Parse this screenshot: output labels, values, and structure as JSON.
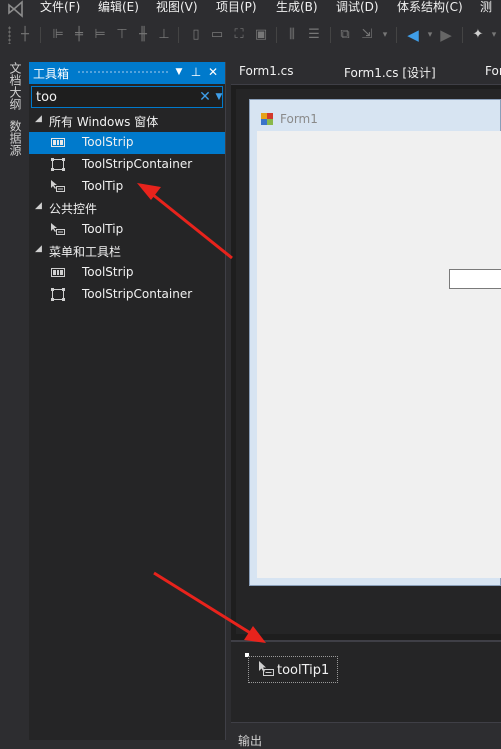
{
  "menu": {
    "items": [
      "文件(F)",
      "编辑(E)",
      "视图(V)",
      "项目(P)",
      "生成(B)",
      "调试(D)",
      "体系结构(C)",
      "测"
    ]
  },
  "left_tabs": [
    "文档大纲",
    "数据源"
  ],
  "toolbox": {
    "title": "工具箱",
    "search": {
      "value": "too",
      "placeholder": ""
    },
    "groups": [
      {
        "label": "所有 Windows 窗体",
        "items": [
          {
            "label": "ToolStrip",
            "icon": "toolstrip-icon",
            "selected": true
          },
          {
            "label": "ToolStripContainer",
            "icon": "toolstripcontainer-icon",
            "selected": false
          },
          {
            "label": "ToolTip",
            "icon": "tooltip-icon",
            "selected": false
          }
        ]
      },
      {
        "label": "公共控件",
        "items": [
          {
            "label": "ToolTip",
            "icon": "tooltip-icon",
            "selected": false
          }
        ]
      },
      {
        "label": "菜单和工具栏",
        "items": [
          {
            "label": "ToolStrip",
            "icon": "toolstrip-icon",
            "selected": false
          },
          {
            "label": "ToolStripContainer",
            "icon": "toolstripcontainer-icon",
            "selected": false
          }
        ]
      }
    ]
  },
  "doc_tabs": [
    "Form1.cs",
    "Form1.cs [设计]",
    "Form"
  ],
  "designer": {
    "form_title": "Form1"
  },
  "tray": {
    "component_label": "toolTip1"
  },
  "output": {
    "title": "输出"
  },
  "colors": {
    "accent": "#007acc",
    "background": "#2d2d30",
    "panel": "#252526",
    "arrow": "#e8231c"
  }
}
